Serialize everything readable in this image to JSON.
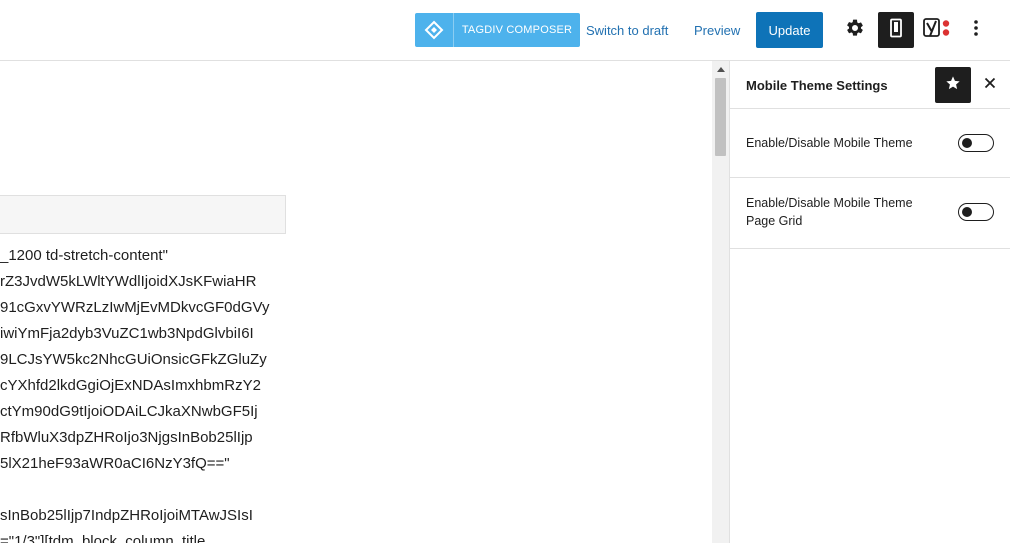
{
  "toolbar": {
    "composer_label": "TAGDIV COMPOSER",
    "switch_to_draft_label": "Switch to draft",
    "preview_label": "Preview",
    "update_label": "Update"
  },
  "editor": {
    "code_lines": [
      "_1200 td-stretch-content\"",
      "rZ3JvdW5kLWltYWdlIjoidXJsKFwiaHR",
      "91cGxvYWRzLzIwMjEvMDkvcGF0dGVy",
      "iwiYmFja2dyb3VuZC1wb3NpdGlvbiI6I",
      "9LCJsYW5kc2NhcGUiOnsicGFkZGluZy",
      "cYXhfd2lkdGgiOjExNDAsImxhbmRzY2",
      "ctYm90dG9tIjoiODAiLCJkaXNwbGF5Ij",
      "RfbWluX3dpZHRoIjo3NjgsInBob25lIjp",
      "5lX21heF93aWR0aCI6NzY3fQ==\"",
      "",
      "sInBob25lIjp7IndpZHRoIjoiMTAwJSIsI",
      "=\"1/3\"][tdm_block_column_title"
    ]
  },
  "sidebar": {
    "title": "Mobile Theme Settings",
    "settings": [
      {
        "label": "Enable/Disable Mobile Theme",
        "enabled": false
      },
      {
        "label": "Enable/Disable Mobile Theme Page Grid",
        "enabled": false
      }
    ]
  },
  "colors": {
    "composer_bg": "#4db2ec",
    "update_bg": "#0e73b8",
    "link": "#2271b1",
    "dark": "#1e1e1e"
  },
  "icons": {
    "composer": "diamond-logo-icon",
    "settings": "gear-icon",
    "mobile": "mobile-phone-icon",
    "yoast": "yoast-seo-icon",
    "more": "vertical-ellipsis-icon",
    "star": "star-icon",
    "close": "close-icon"
  }
}
